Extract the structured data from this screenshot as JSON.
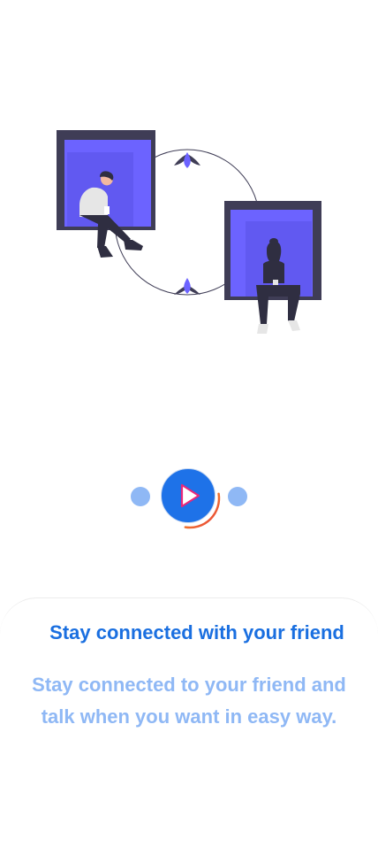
{
  "illustration": {
    "name": "two people sitting in window frames connected by a circle"
  },
  "pager": {
    "pages_total": 3,
    "current_page": 2,
    "progress_fraction": 0.3,
    "play_icon": "play-icon"
  },
  "colors": {
    "accent_blue": "#1e72e8",
    "title_blue": "#1a6fe0",
    "light_blue": "#8fb8f5",
    "window_purple": "#6c63ff",
    "window_frame": "#3f3d56",
    "progress_orange": "#f5a623",
    "progress_red": "#e83a3a"
  },
  "onboarding": {
    "title": "Stay connected with your friend",
    "description": "Stay connected to your friend and talk when you want in easy way."
  }
}
